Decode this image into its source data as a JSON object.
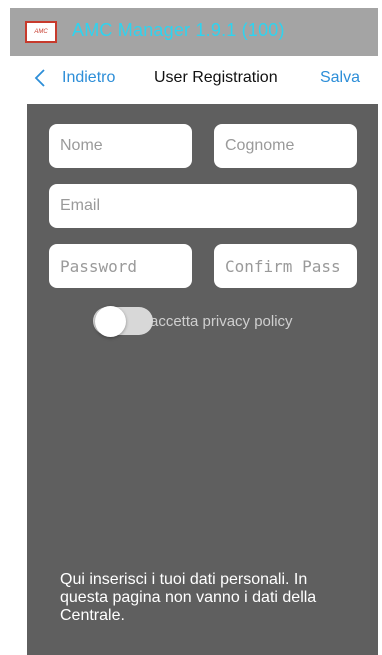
{
  "app": {
    "title": "AMC Manager 1.9.1 (100)",
    "logo_text": "AMC",
    "title_color": "#2fd3ef"
  },
  "navbar": {
    "back_label": "Indietro",
    "title": "User Registration",
    "save_label": "Salva",
    "accent_color": "#2d8ed8"
  },
  "form": {
    "nome_placeholder": "Nome",
    "cognome_placeholder": "Cognome",
    "email_placeholder": "Email",
    "password_placeholder": "Password",
    "confirm_placeholder": "Confirm Pass",
    "privacy_toggle": {
      "label": "accetta privacy policy",
      "checked": false
    }
  },
  "info": {
    "text": "Qui inserisci i tuoi dati personali. In questa pagina non vanno i dati della Centrale."
  }
}
